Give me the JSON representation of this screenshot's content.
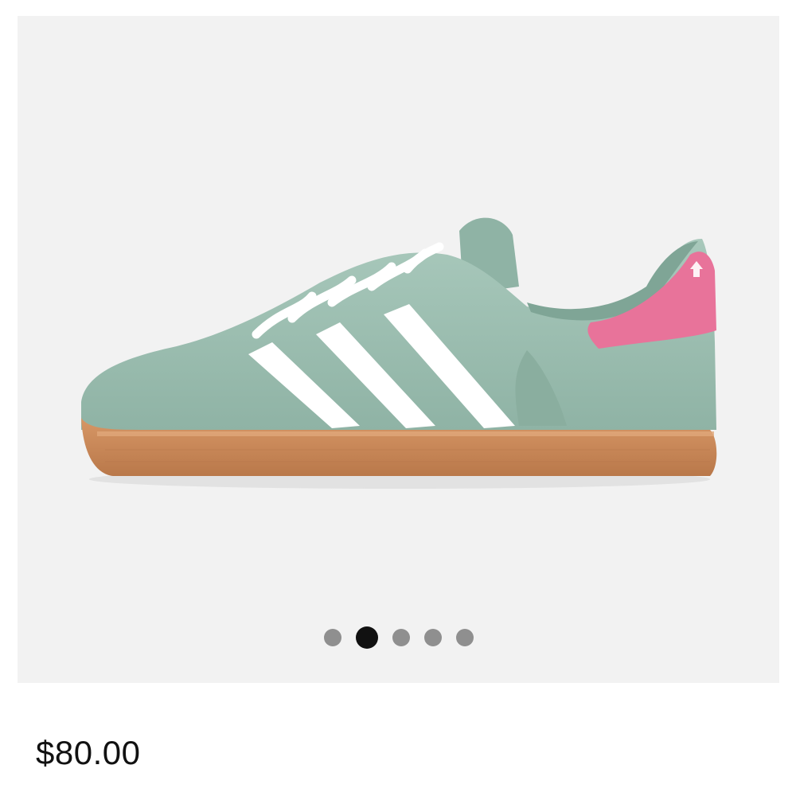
{
  "product": {
    "image_icon": "sneaker-image",
    "price": "$80.00",
    "colors": {
      "upper": "#9bbdb0",
      "stripes": "#ffffff",
      "sole": "#c98a5a",
      "heel_tab": "#e8739a"
    }
  },
  "gallery": {
    "total_images": 5,
    "active_index": 2,
    "dots": [
      {
        "label": "1",
        "active": false
      },
      {
        "label": "2",
        "active": true
      },
      {
        "label": "3",
        "active": false
      },
      {
        "label": "4",
        "active": false
      },
      {
        "label": "5",
        "active": false
      }
    ]
  }
}
